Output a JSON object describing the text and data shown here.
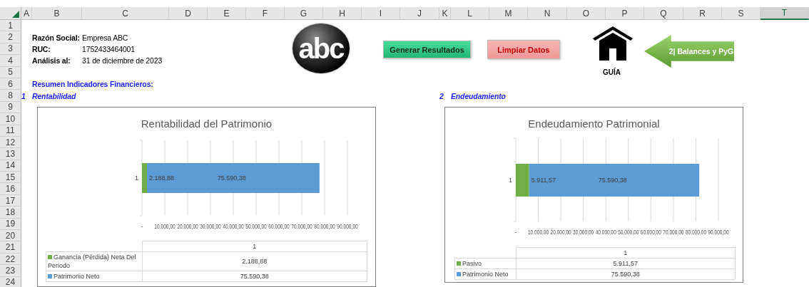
{
  "sheet": {
    "columns": [
      {
        "label": "A",
        "selected": false
      },
      {
        "label": "B",
        "selected": false
      },
      {
        "label": "C",
        "selected": false
      },
      {
        "label": "D",
        "selected": false
      },
      {
        "label": "E",
        "selected": false
      },
      {
        "label": "F",
        "selected": false
      },
      {
        "label": "G",
        "selected": false
      },
      {
        "label": "H",
        "selected": false
      },
      {
        "label": "I",
        "selected": false
      },
      {
        "label": "J",
        "selected": false
      },
      {
        "label": "K",
        "selected": false
      },
      {
        "label": "L",
        "selected": false
      },
      {
        "label": "M",
        "selected": false
      },
      {
        "label": "N",
        "selected": false
      },
      {
        "label": "O",
        "selected": false
      },
      {
        "label": "P",
        "selected": false
      },
      {
        "label": "Q",
        "selected": false
      },
      {
        "label": "R",
        "selected": false
      },
      {
        "label": "S",
        "selected": false
      },
      {
        "label": "T",
        "selected": true
      }
    ],
    "rows": [
      "1",
      "2",
      "3",
      "4",
      "5",
      "6",
      "8",
      "9",
      "10",
      "11",
      "12",
      "13",
      "14",
      "15",
      "16",
      "17",
      "18",
      "19",
      "20",
      "21",
      "22",
      "23",
      "24"
    ]
  },
  "company_info": [
    {
      "label": "Razón Social:",
      "value": "Empresa ABC"
    },
    {
      "label": "RUC:",
      "value": "1752433464001"
    },
    {
      "label": "Análisis al:",
      "value": "31 de diciembre de 2023"
    }
  ],
  "logo": {
    "text": "abc"
  },
  "buttons": [
    {
      "label": "Generar Resultados",
      "kind": "generate"
    },
    {
      "label": "Limpiar Datos",
      "kind": "clear"
    }
  ],
  "guide": {
    "label": "GUÍA"
  },
  "nav_arrow": {
    "label": "2| Balances y PyG"
  },
  "summary_heading": "Resumen Indicadores Financieros:",
  "sections": [
    {
      "number": "1",
      "title": "Rentabilidad",
      "chart": {
        "chart_data": {
          "type": "bar",
          "orientation": "horizontal",
          "stacked": true,
          "grid": true,
          "legend": true,
          "title": "Rentabilidad del Patrimonio",
          "categories": [
            "1"
          ],
          "series": [
            {
              "name": "Ganancia (Pérdida) Neta Del Periodo",
              "color": "#70ad47",
              "values": [
                2188.88
              ]
            },
            {
              "name": "Patrimonio Neto",
              "color": "#5b9bd5",
              "values": [
                75590.38
              ]
            }
          ],
          "xlim": [
            0,
            90000
          ],
          "xticks": [
            {
              "value": 0,
              "label": "-"
            },
            {
              "value": 10000,
              "label": "10.000,00"
            },
            {
              "value": 20000,
              "label": "20.000,00"
            },
            {
              "value": 30000,
              "label": "30.000,00"
            },
            {
              "value": 40000,
              "label": "40.000,00"
            },
            {
              "value": 50000,
              "label": "50.000,00"
            },
            {
              "value": 60000,
              "label": "60.000,00"
            },
            {
              "value": 70000,
              "label": "70.000,00"
            },
            {
              "value": 80000,
              "label": "80.000,00"
            },
            {
              "value": 90000,
              "label": "90.000,00"
            }
          ],
          "value_labels": [
            "2.188,88",
            "75.590,38"
          ]
        },
        "data_table": {
          "header": "1",
          "values": [
            "2.188,88",
            "75.590,38"
          ]
        }
      }
    },
    {
      "number": "2",
      "title": "Endeudamiento",
      "chart": {
        "chart_data": {
          "type": "bar",
          "orientation": "horizontal",
          "stacked": true,
          "grid": true,
          "legend": true,
          "title": "Endeudamiento Patrimonial",
          "categories": [
            "1"
          ],
          "series": [
            {
              "name": "Pasivo",
              "color": "#70ad47",
              "values": [
                5911.57
              ]
            },
            {
              "name": "Patrimonio Neto",
              "color": "#5b9bd5",
              "values": [
                75590.38
              ]
            }
          ],
          "xlim": [
            0,
            90000
          ],
          "xticks": [
            {
              "value": 0,
              "label": "-"
            },
            {
              "value": 10000,
              "label": "10.000,00"
            },
            {
              "value": 20000,
              "label": "20.000,00"
            },
            {
              "value": 30000,
              "label": "30.000,00"
            },
            {
              "value": 40000,
              "label": "40.000,00"
            },
            {
              "value": 50000,
              "label": "50.000,00"
            },
            {
              "value": 60000,
              "label": "60.000,00"
            },
            {
              "value": 70000,
              "label": "70.000,00"
            },
            {
              "value": 80000,
              "label": "80.000,00"
            },
            {
              "value": 90000,
              "label": "90.000,00"
            }
          ],
          "value_labels": [
            "5.911,57",
            "75.590,38"
          ]
        },
        "data_table": {
          "header": "1",
          "values": [
            "5.911,57",
            "75.590,38"
          ]
        }
      }
    }
  ]
}
